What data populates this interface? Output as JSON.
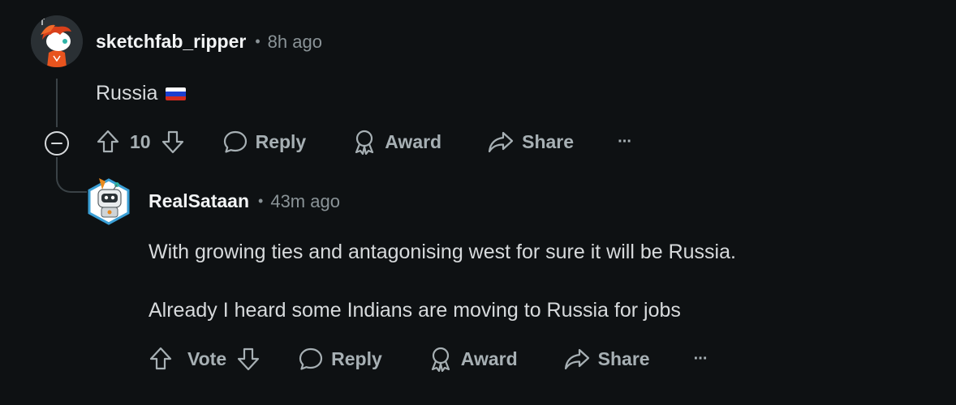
{
  "comment": {
    "username": "sketchfab_ripper",
    "separator": "•",
    "time": "8h ago",
    "body": "Russia",
    "flag_colors": [
      "#ffffff",
      "#1c3fcf",
      "#d52b1e"
    ],
    "actions": {
      "upvote_icon": "arrow-up-icon",
      "score": "10",
      "downvote_icon": "arrow-down-icon",
      "reply": "Reply",
      "award": "Award",
      "share": "Share",
      "more": "···"
    }
  },
  "reply": {
    "username": "RealSataan",
    "separator": "•",
    "time": "43m ago",
    "body_lines": [
      "With growing ties and antagonising west for sure it will be Russia.",
      "Already I heard some Indians are moving to Russia for jobs"
    ],
    "actions": {
      "vote": "Vote",
      "reply": "Reply",
      "award": "Award",
      "share": "Share",
      "more": "···"
    }
  },
  "colors": {
    "background": "#0e1113",
    "text_primary": "#f2f4f5",
    "text_secondary": "#8a9397",
    "action": "#a7b0b4",
    "thread_line": "#3a4246"
  }
}
